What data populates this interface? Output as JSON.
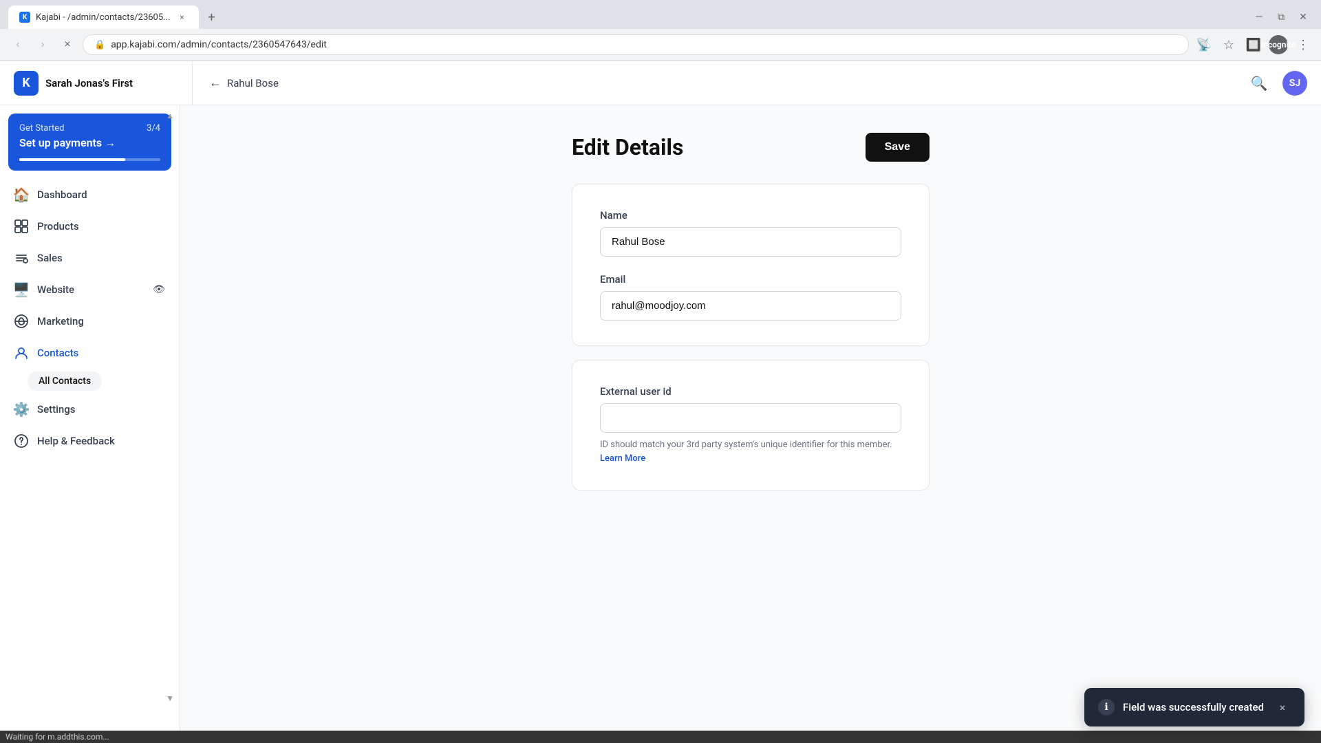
{
  "browser": {
    "tab_title": "Kajabi - /admin/contacts/23605...",
    "favicon_text": "K",
    "url": "app.kajabi.com/admin/contacts/2360547643/edit",
    "new_tab_label": "+",
    "back_disabled": false,
    "forward_disabled": true,
    "reload_label": "×",
    "incognito_label": "Incognito",
    "status_bar": "Waiting for m.addthis.com..."
  },
  "header": {
    "logo_text": "Sarah Jonas's First",
    "logo_letter": "K",
    "back_label": "Rahul Bose",
    "avatar_initials": "SJ"
  },
  "sidebar": {
    "get_started": {
      "label": "Get Started",
      "badge": "3/4",
      "action": "Set up payments →",
      "progress": 75
    },
    "nav_items": [
      {
        "id": "dashboard",
        "label": "Dashboard",
        "icon": "🏠"
      },
      {
        "id": "products",
        "label": "Products",
        "icon": "📦"
      },
      {
        "id": "sales",
        "label": "Sales",
        "icon": "🏷️"
      },
      {
        "id": "website",
        "label": "Website",
        "icon": "🖥️",
        "has_badge": true
      },
      {
        "id": "marketing",
        "label": "Marketing",
        "icon": "📣"
      },
      {
        "id": "contacts",
        "label": "Contacts",
        "icon": "👤",
        "active": true
      },
      {
        "id": "settings",
        "label": "Settings",
        "icon": "⚙️"
      },
      {
        "id": "help",
        "label": "Help & Feedback",
        "icon": "❓"
      }
    ],
    "sub_nav": [
      {
        "id": "all-contacts",
        "label": "All Contacts",
        "active": true
      }
    ]
  },
  "main": {
    "title": "Edit Details",
    "save_button": "Save",
    "form": {
      "name_label": "Name",
      "name_value": "Rahul Bose",
      "email_label": "Email",
      "email_value": "rahul@moodjoy.com",
      "external_id_label": "External user id",
      "external_id_value": "",
      "external_id_help": "ID should match your 3rd party system's unique identifier for this member.",
      "learn_more_label": "Learn More"
    }
  },
  "toast": {
    "text": "Field was successfully created",
    "icon": "ℹ",
    "close": "×"
  }
}
